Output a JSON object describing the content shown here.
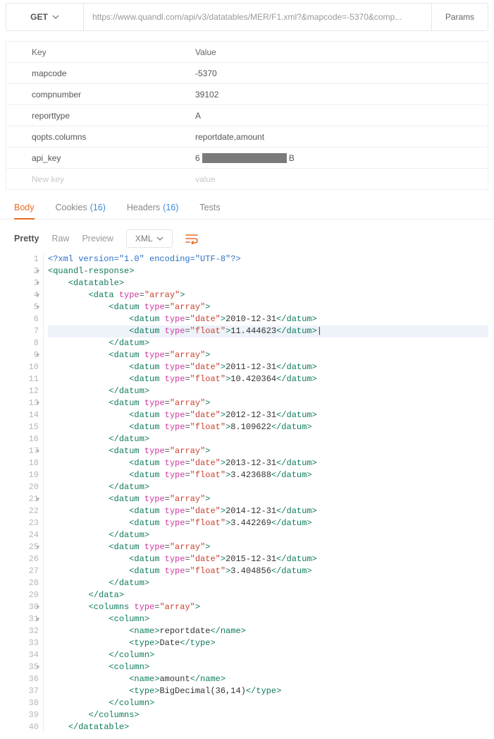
{
  "request": {
    "method": "GET",
    "url": "https://www.quandl.com/api/v3/datatables/MER/F1.xml?&mapcode=-5370&comp...",
    "params_btn": "Params"
  },
  "params": {
    "header_key": "Key",
    "header_value": "Value",
    "new_key_ph": "New key",
    "new_val_ph": "value",
    "rows": [
      {
        "k": "mapcode",
        "v": "-5370"
      },
      {
        "k": "compnumber",
        "v": "39102"
      },
      {
        "k": "reporttype",
        "v": "A"
      },
      {
        "k": "qopts.columns",
        "v": "reportdate,amount"
      },
      {
        "k": "api_key",
        "v_prefix": "6",
        "v_suffix": "B",
        "redacted": true
      }
    ]
  },
  "tabs": {
    "body": "Body",
    "cookies": "Cookies",
    "cookies_count": "(16)",
    "headers": "Headers",
    "headers_count": "(16)",
    "tests": "Tests"
  },
  "toolbar": {
    "pretty": "Pretty",
    "raw": "Raw",
    "preview": "Preview",
    "format": "XML"
  },
  "code": {
    "lines": [
      {
        "n": 1,
        "i": 0,
        "html": "<span class='x1'>&lt;?xml version=\"1.0\" encoding=\"UTF-8\"?&gt;</span>"
      },
      {
        "n": 2,
        "i": 0,
        "fold": true,
        "html": "<span class='tg'>&lt;quandl-response&gt;</span>"
      },
      {
        "n": 3,
        "i": 1,
        "fold": true,
        "html": "<span class='tg'>&lt;datatable&gt;</span>"
      },
      {
        "n": 4,
        "i": 2,
        "fold": true,
        "html": "<span class='tg'>&lt;data</span> <span class='at'>type</span>=<span class='red'>\"array\"</span><span class='tg'>&gt;</span>"
      },
      {
        "n": 5,
        "i": 3,
        "fold": true,
        "html": "<span class='tg'>&lt;datum</span> <span class='at'>type</span>=<span class='red'>\"array\"</span><span class='tg'>&gt;</span>"
      },
      {
        "n": 6,
        "i": 4,
        "html": "<span class='tg'>&lt;datum</span> <span class='at'>type</span>=<span class='red'>\"date\"</span><span class='tg'>&gt;</span><span class='tx'>2010-12-31</span><span class='tg'>&lt;/datum&gt;</span>"
      },
      {
        "n": 7,
        "i": 4,
        "hl": true,
        "html": "<span class='tg'>&lt;datum</span> <span class='at'>type</span>=<span class='red'>\"float\"</span><span class='tg'>&gt;</span><span class='tx'>11.444623</span><span class='tg'>&lt;/datum&gt;</span><span class='tx'>|</span>"
      },
      {
        "n": 8,
        "i": 3,
        "html": "<span class='tg'>&lt;/datum&gt;</span>"
      },
      {
        "n": 9,
        "i": 3,
        "fold": true,
        "html": "<span class='tg'>&lt;datum</span> <span class='at'>type</span>=<span class='red'>\"array\"</span><span class='tg'>&gt;</span>"
      },
      {
        "n": 10,
        "i": 4,
        "html": "<span class='tg'>&lt;datum</span> <span class='at'>type</span>=<span class='red'>\"date\"</span><span class='tg'>&gt;</span><span class='tx'>2011-12-31</span><span class='tg'>&lt;/datum&gt;</span>"
      },
      {
        "n": 11,
        "i": 4,
        "html": "<span class='tg'>&lt;datum</span> <span class='at'>type</span>=<span class='red'>\"float\"</span><span class='tg'>&gt;</span><span class='tx'>10.420364</span><span class='tg'>&lt;/datum&gt;</span>"
      },
      {
        "n": 12,
        "i": 3,
        "html": "<span class='tg'>&lt;/datum&gt;</span>"
      },
      {
        "n": 13,
        "i": 3,
        "fold": true,
        "html": "<span class='tg'>&lt;datum</span> <span class='at'>type</span>=<span class='red'>\"array\"</span><span class='tg'>&gt;</span>"
      },
      {
        "n": 14,
        "i": 4,
        "html": "<span class='tg'>&lt;datum</span> <span class='at'>type</span>=<span class='red'>\"date\"</span><span class='tg'>&gt;</span><span class='tx'>2012-12-31</span><span class='tg'>&lt;/datum&gt;</span>"
      },
      {
        "n": 15,
        "i": 4,
        "html": "<span class='tg'>&lt;datum</span> <span class='at'>type</span>=<span class='red'>\"float\"</span><span class='tg'>&gt;</span><span class='tx'>8.109622</span><span class='tg'>&lt;/datum&gt;</span>"
      },
      {
        "n": 16,
        "i": 3,
        "html": "<span class='tg'>&lt;/datum&gt;</span>"
      },
      {
        "n": 17,
        "i": 3,
        "fold": true,
        "html": "<span class='tg'>&lt;datum</span> <span class='at'>type</span>=<span class='red'>\"array\"</span><span class='tg'>&gt;</span>"
      },
      {
        "n": 18,
        "i": 4,
        "html": "<span class='tg'>&lt;datum</span> <span class='at'>type</span>=<span class='red'>\"date\"</span><span class='tg'>&gt;</span><span class='tx'>2013-12-31</span><span class='tg'>&lt;/datum&gt;</span>"
      },
      {
        "n": 19,
        "i": 4,
        "html": "<span class='tg'>&lt;datum</span> <span class='at'>type</span>=<span class='red'>\"float\"</span><span class='tg'>&gt;</span><span class='tx'>3.423688</span><span class='tg'>&lt;/datum&gt;</span>"
      },
      {
        "n": 20,
        "i": 3,
        "html": "<span class='tg'>&lt;/datum&gt;</span>"
      },
      {
        "n": 21,
        "i": 3,
        "fold": true,
        "html": "<span class='tg'>&lt;datum</span> <span class='at'>type</span>=<span class='red'>\"array\"</span><span class='tg'>&gt;</span>"
      },
      {
        "n": 22,
        "i": 4,
        "html": "<span class='tg'>&lt;datum</span> <span class='at'>type</span>=<span class='red'>\"date\"</span><span class='tg'>&gt;</span><span class='tx'>2014-12-31</span><span class='tg'>&lt;/datum&gt;</span>"
      },
      {
        "n": 23,
        "i": 4,
        "html": "<span class='tg'>&lt;datum</span> <span class='at'>type</span>=<span class='red'>\"float\"</span><span class='tg'>&gt;</span><span class='tx'>3.442269</span><span class='tg'>&lt;/datum&gt;</span>"
      },
      {
        "n": 24,
        "i": 3,
        "html": "<span class='tg'>&lt;/datum&gt;</span>"
      },
      {
        "n": 25,
        "i": 3,
        "fold": true,
        "html": "<span class='tg'>&lt;datum</span> <span class='at'>type</span>=<span class='red'>\"array\"</span><span class='tg'>&gt;</span>"
      },
      {
        "n": 26,
        "i": 4,
        "html": "<span class='tg'>&lt;datum</span> <span class='at'>type</span>=<span class='red'>\"date\"</span><span class='tg'>&gt;</span><span class='tx'>2015-12-31</span><span class='tg'>&lt;/datum&gt;</span>"
      },
      {
        "n": 27,
        "i": 4,
        "html": "<span class='tg'>&lt;datum</span> <span class='at'>type</span>=<span class='red'>\"float\"</span><span class='tg'>&gt;</span><span class='tx'>3.404856</span><span class='tg'>&lt;/datum&gt;</span>"
      },
      {
        "n": 28,
        "i": 3,
        "html": "<span class='tg'>&lt;/datum&gt;</span>"
      },
      {
        "n": 29,
        "i": 2,
        "html": "<span class='tg'>&lt;/data&gt;</span>"
      },
      {
        "n": 30,
        "i": 2,
        "fold": true,
        "html": "<span class='tg'>&lt;columns</span> <span class='at'>type</span>=<span class='red'>\"array\"</span><span class='tg'>&gt;</span>"
      },
      {
        "n": 31,
        "i": 3,
        "fold": true,
        "html": "<span class='tg'>&lt;column&gt;</span>"
      },
      {
        "n": 32,
        "i": 4,
        "html": "<span class='tg'>&lt;name&gt;</span><span class='tx'>reportdate</span><span class='tg'>&lt;/name&gt;</span>"
      },
      {
        "n": 33,
        "i": 4,
        "html": "<span class='tg'>&lt;type&gt;</span><span class='tx'>Date</span><span class='tg'>&lt;/type&gt;</span>"
      },
      {
        "n": 34,
        "i": 3,
        "html": "<span class='tg'>&lt;/column&gt;</span>"
      },
      {
        "n": 35,
        "i": 3,
        "fold": true,
        "html": "<span class='tg'>&lt;column&gt;</span>"
      },
      {
        "n": 36,
        "i": 4,
        "html": "<span class='tg'>&lt;name&gt;</span><span class='tx'>amount</span><span class='tg'>&lt;/name&gt;</span>"
      },
      {
        "n": 37,
        "i": 4,
        "html": "<span class='tg'>&lt;type&gt;</span><span class='tx'>BigDecimal(36,14)</span><span class='tg'>&lt;/type&gt;</span>"
      },
      {
        "n": 38,
        "i": 3,
        "html": "<span class='tg'>&lt;/column&gt;</span>"
      },
      {
        "n": 39,
        "i": 2,
        "html": "<span class='tg'>&lt;/columns&gt;</span>"
      },
      {
        "n": 40,
        "i": 1,
        "html": "<span class='tg'>&lt;/datatable&gt;</span>"
      }
    ]
  }
}
